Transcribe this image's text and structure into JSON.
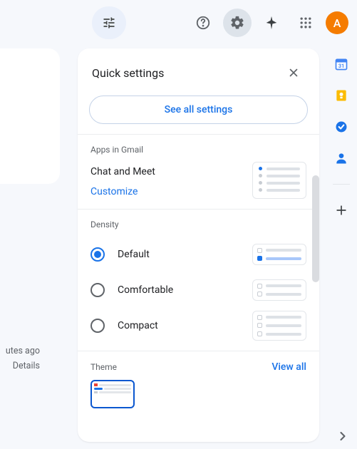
{
  "topbar": {
    "avatar_initial": "A"
  },
  "background": {
    "time_ago": "utes ago",
    "details": "Details"
  },
  "panel": {
    "title": "Quick settings",
    "see_all": "See all settings",
    "apps": {
      "section_title": "Apps in Gmail",
      "chat_meet": "Chat and Meet",
      "customize": "Customize"
    },
    "density": {
      "section_title": "Density",
      "options": {
        "0": "Default",
        "1": "Comfortable",
        "2": "Compact"
      }
    },
    "theme": {
      "section_title": "Theme",
      "view_all": "View all"
    }
  }
}
